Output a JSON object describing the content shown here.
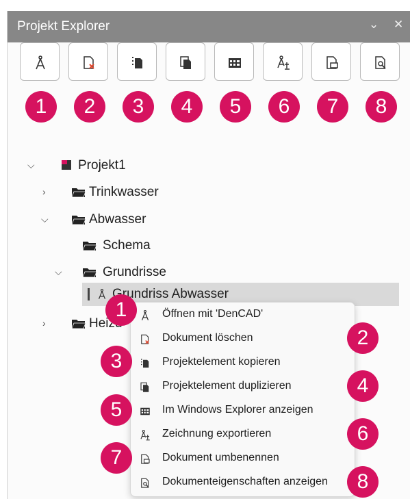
{
  "panel": {
    "title": "Projekt Explorer",
    "controls": {
      "dropdown": "⌄",
      "close": "✕"
    }
  },
  "toolbar": {
    "buttons": [
      {
        "icon": "compass-icon",
        "badge": "1"
      },
      {
        "icon": "delete-document-icon",
        "badge": "2"
      },
      {
        "icon": "copy-element-icon",
        "badge": "3"
      },
      {
        "icon": "duplicate-element-icon",
        "badge": "4"
      },
      {
        "icon": "windows-explorer-icon",
        "badge": "5"
      },
      {
        "icon": "export-drawing-icon",
        "badge": "6"
      },
      {
        "icon": "rename-document-icon",
        "badge": "7"
      },
      {
        "icon": "document-properties-icon",
        "badge": "8"
      }
    ]
  },
  "tree": {
    "project": "Projekt1",
    "trinkwasser": "Trinkwasser",
    "abwasser": "Abwasser",
    "schema": "Schema",
    "grundrisse": "Grundrisse",
    "grundriss_selected": "Grundriss Abwasser",
    "heizung": "Heizu"
  },
  "context_menu": {
    "items": [
      {
        "label": "Öffnen mit 'DenCAD'",
        "icon": "compass-icon",
        "badge": "1"
      },
      {
        "label": "Dokument löschen",
        "icon": "delete-document-icon",
        "badge": "2"
      },
      {
        "label": "Projektelement kopieren",
        "icon": "copy-element-icon",
        "badge": "3"
      },
      {
        "label": "Projektelement duplizieren",
        "icon": "duplicate-element-icon",
        "badge": "4"
      },
      {
        "label": "Im Windows Explorer anzeigen",
        "icon": "windows-explorer-icon",
        "badge": "5"
      },
      {
        "label": "Zeichnung exportieren",
        "icon": "export-drawing-icon",
        "badge": "6"
      },
      {
        "label": "Dokument umbenennen",
        "icon": "rename-document-icon",
        "badge": "7"
      },
      {
        "label": "Dokumenteigenschaften anzeigen",
        "icon": "document-properties-icon",
        "badge": "8"
      }
    ]
  },
  "colors": {
    "badge": "#d6125f",
    "titlebar": "#878787",
    "selection": "#d9d9d9",
    "delete_accent": "#e0452b"
  }
}
